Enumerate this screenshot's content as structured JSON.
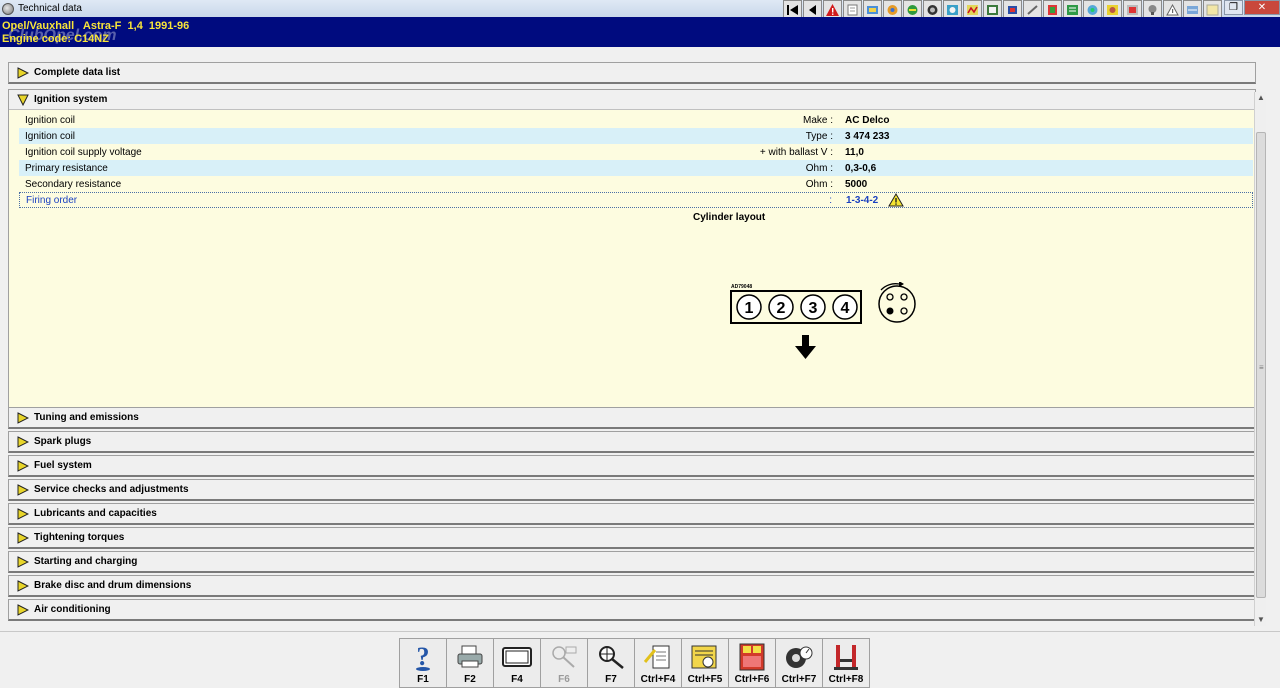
{
  "window": {
    "title": "Technical data"
  },
  "vehicle": {
    "model_line": "Opel/Vauxhall   Astra-F  1,4  1991-96",
    "engine_line": "Engine code: C14NZ",
    "watermark": "ClubOpel.com"
  },
  "sections": {
    "complete_data_list": "Complete data list",
    "ignition_system": "Ignition system",
    "collapsed": [
      "Tuning and emissions",
      "Spark plugs",
      "Fuel system",
      "Service checks and adjustments",
      "Lubricants and capacities",
      "Tightening torques",
      "Starting and charging",
      "Brake disc and drum dimensions",
      "Air conditioning"
    ]
  },
  "ignition_rows": [
    {
      "label": "Ignition coil",
      "unit": "Make :",
      "value": "AC Delco"
    },
    {
      "label": "Ignition coil",
      "unit": "Type :",
      "value": "3 474 233"
    },
    {
      "label": "Ignition coil supply voltage",
      "unit": "+ with ballast  V :",
      "value": "11,0"
    },
    {
      "label": "Primary resistance",
      "unit": "Ohm :",
      "value": "0,3-0,6"
    },
    {
      "label": "Secondary resistance",
      "unit": "Ohm :",
      "value": "5000"
    },
    {
      "label": "Firing order",
      "unit": ":",
      "value": "1-3-4-2"
    }
  ],
  "diagram": {
    "title": "Cylinder layout",
    "code": "AD79048",
    "cylinders": [
      "1",
      "2",
      "3",
      "4"
    ]
  },
  "fkeys": [
    {
      "label": "F1",
      "icon": "help-icon"
    },
    {
      "label": "F2",
      "icon": "printer-icon"
    },
    {
      "label": "F4",
      "icon": "window-icon"
    },
    {
      "label": "F6",
      "icon": "disabled-tool-icon"
    },
    {
      "label": "F7",
      "icon": "search-tool-icon"
    },
    {
      "label": "Ctrl+F4",
      "icon": "document-edit-icon"
    },
    {
      "label": "Ctrl+F5",
      "icon": "card-icon"
    },
    {
      "label": "Ctrl+F6",
      "icon": "calendar-icon"
    },
    {
      "label": "Ctrl+F7",
      "icon": "gauge-icon"
    },
    {
      "label": "Ctrl+F8",
      "icon": "lift-icon"
    }
  ],
  "colors": {
    "header_bg": "#000b7f",
    "header_text": "#f7e43a",
    "panel_bg": "#fdfce0",
    "row_alt": "#d8f0f8",
    "selected_text": "#1a40c0"
  }
}
